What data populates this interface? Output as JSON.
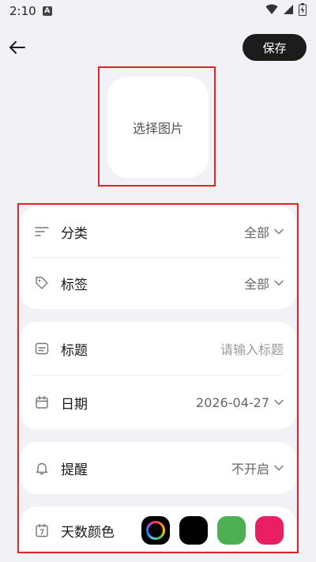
{
  "status_bar": {
    "time": "2:10",
    "notification_glyph": "A",
    "icons": [
      "wifi-icon",
      "signal-icon",
      "battery-icon"
    ]
  },
  "header": {
    "back_icon": "arrow-left-icon",
    "save_label": "保存"
  },
  "image_picker": {
    "label": "选择图片"
  },
  "form": {
    "category": {
      "label": "分类",
      "value": "全部",
      "icon": "sort-lines-icon"
    },
    "tag": {
      "label": "标签",
      "value": "全部",
      "icon": "tag-icon"
    },
    "title": {
      "label": "标题",
      "placeholder": "请输入标题",
      "icon": "title-icon"
    },
    "date": {
      "label": "日期",
      "value": "2026-04-27",
      "icon": "calendar-icon"
    },
    "reminder": {
      "label": "提醒",
      "value": "不开启",
      "icon": "bell-icon"
    },
    "day_color": {
      "label": "天数颜色",
      "icon": "calendar-7-icon",
      "swatches": [
        "rainbow",
        "#000000",
        "#4caf50",
        "#e91e63"
      ]
    }
  },
  "colors": {
    "background": "#f2f2f6",
    "card": "#ffffff",
    "save_button": "#1c1c1c",
    "highlight": "#e02424"
  }
}
